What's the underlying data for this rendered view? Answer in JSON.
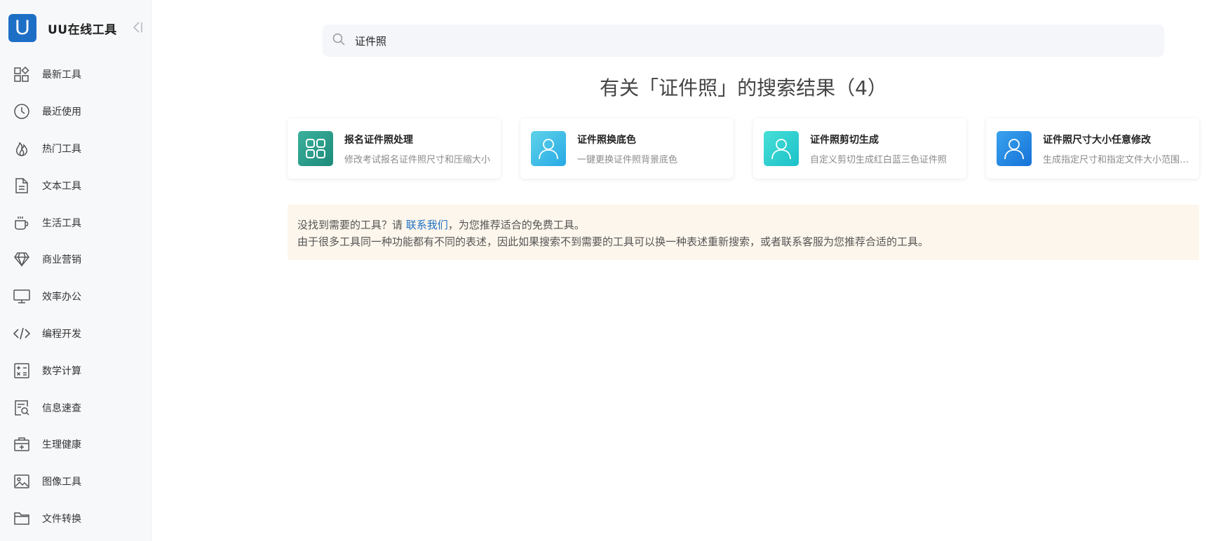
{
  "brand": {
    "logo_letter": "U",
    "name": "UU在线工具"
  },
  "sidebar": {
    "items": [
      {
        "label": "最新工具",
        "icon": "grid-shapes-icon"
      },
      {
        "label": "最近使用",
        "icon": "clock-icon"
      },
      {
        "label": "热门工具",
        "icon": "flame-icon"
      },
      {
        "label": "文本工具",
        "icon": "document-icon"
      },
      {
        "label": "生活工具",
        "icon": "cup-icon"
      },
      {
        "label": "商业营销",
        "icon": "diamond-icon"
      },
      {
        "label": "效率办公",
        "icon": "monitor-icon"
      },
      {
        "label": "编程开发",
        "icon": "code-icon"
      },
      {
        "label": "数学计算",
        "icon": "calculator-icon"
      },
      {
        "label": "信息速查",
        "icon": "search-doc-icon"
      },
      {
        "label": "生理健康",
        "icon": "medical-kit-icon"
      },
      {
        "label": "图像工具",
        "icon": "image-icon"
      },
      {
        "label": "文件转换",
        "icon": "folder-icon"
      }
    ]
  },
  "search": {
    "value": "证件照",
    "icon": "search-icon"
  },
  "results": {
    "title": "有关「证件照」的搜索结果（4）",
    "cards": [
      {
        "title": "报名证件照处理",
        "desc": "修改考试报名证件照尺寸和压缩大小",
        "icon": "apps-grid-icon"
      },
      {
        "title": "证件照换底色",
        "desc": "一键更换证件照背景底色",
        "icon": "person-icon"
      },
      {
        "title": "证件照剪切生成",
        "desc": "自定义剪切生成红白蓝三色证件照",
        "icon": "person-icon"
      },
      {
        "title": "证件照尺寸大小任意修改",
        "desc": "生成指定尺寸和指定文件大小范围的证件照",
        "icon": "person-icon"
      }
    ]
  },
  "notice": {
    "line1_prefix": "没找到需要的工具？请 ",
    "link": "联系我们",
    "line1_suffix": "，为您推荐适合的免费工具。",
    "line2": "由于很多工具同一种功能都有不同的表述，因此如果搜索不到需要的工具可以换一种表述重新搜索，或者联系客服为您推荐合适的工具。"
  },
  "colors": {
    "brand": "#1d6fc6",
    "notice_bg": "#fdf6ec",
    "card1_gradient": [
      "#3ab19b",
      "#1e8a7a"
    ],
    "card2_gradient": [
      "#5fd3e8",
      "#27a9e6"
    ],
    "card3_gradient": [
      "#46dfd6",
      "#1cc1c9"
    ],
    "card4_gradient": [
      "#3aa3ee",
      "#1572d8"
    ]
  }
}
